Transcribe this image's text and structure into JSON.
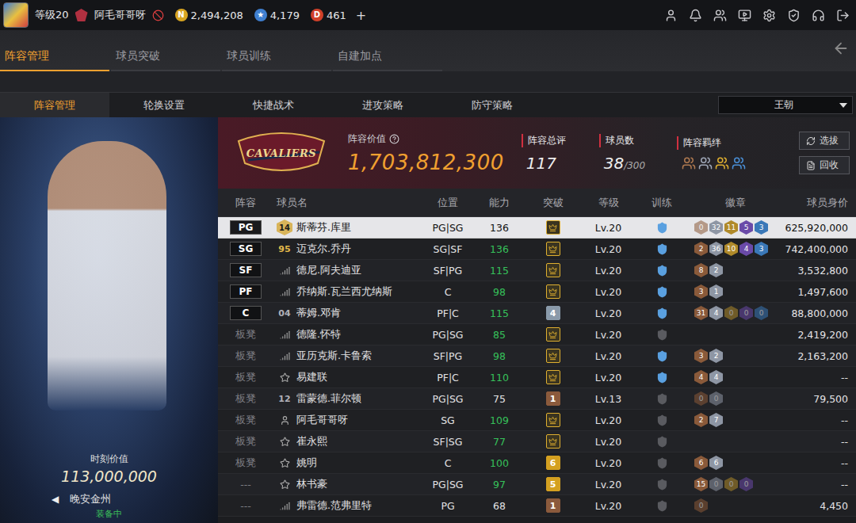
{
  "top_bar": {
    "level": "等级20",
    "player_name": "阿毛哥哥呀",
    "currencies": [
      {
        "icon": "N",
        "value": "2,494,208",
        "color": "#d9a520"
      },
      {
        "icon": "★",
        "value": "4,179",
        "color": "#3f7fd0"
      },
      {
        "icon": "D",
        "value": "461",
        "color": "#d0402a"
      }
    ],
    "add": "+"
  },
  "main_tabs": [
    {
      "label": "阵容管理",
      "selected": true
    },
    {
      "label": "球员突破",
      "selected": false
    },
    {
      "label": "球员训练",
      "selected": false
    },
    {
      "label": "自建加点",
      "selected": false
    }
  ],
  "sub_tabs": [
    {
      "label": "阵容管理",
      "selected": true
    },
    {
      "label": "轮换设置",
      "selected": false
    },
    {
      "label": "快捷战术",
      "selected": false
    },
    {
      "label": "进攻策略",
      "selected": false
    },
    {
      "label": "防守策略",
      "selected": false
    }
  ],
  "dropdown": {
    "value": "王朝"
  },
  "player_card": {
    "value_label": "时刻价值",
    "value": "113,000,000",
    "prev": "◀",
    "name": "晚安金州",
    "status": "装备中"
  },
  "team": {
    "logo_text": "CAVALIERS",
    "value_label": "阵容价值",
    "value": "1,703,812,300",
    "rating_label": "阵容总评",
    "rating": "117",
    "count_label": "球员数",
    "count": "38",
    "count_max": "/300",
    "bonds_label": "阵容羁绊",
    "bonds": [
      {
        "color": "#b07a50"
      },
      {
        "color": "#a0a8b8"
      },
      {
        "color": "#e0b030"
      },
      {
        "color": "#4a90d8"
      }
    ],
    "buttons": [
      "选拔",
      "回收"
    ]
  },
  "table": {
    "columns": [
      "阵容",
      "球员名",
      "位置",
      "能力",
      "突破",
      "等级",
      "训练",
      "徽章",
      "球员身价"
    ],
    "rows": [
      {
        "lineup": "PG",
        "starter": true,
        "marker": {
          "kind": "number",
          "text": "14",
          "color": "#d8b45a"
        },
        "name": "斯蒂芬.库里",
        "position": "PG|SG",
        "ability": "136",
        "boosted": false,
        "breakthrough": {
          "kind": "crown",
          "color": "#e0b030"
        },
        "level": "Lv.20",
        "trained": true,
        "badges": [
          "0",
          "32",
          "11",
          "5",
          "3"
        ],
        "value": "625,920,000",
        "selected": true
      },
      {
        "lineup": "SG",
        "starter": true,
        "marker": {
          "kind": "number",
          "text": "95",
          "color": "#e0b84a"
        },
        "name": "迈克尔.乔丹",
        "position": "SG|SF",
        "ability": "136",
        "boosted": true,
        "breakthrough": {
          "kind": "crown",
          "color": "#e0b030"
        },
        "level": "Lv.20",
        "trained": true,
        "badges": [
          "2",
          "36",
          "10",
          "4",
          "3"
        ],
        "value": "742,400,000",
        "selected": false
      },
      {
        "lineup": "SF",
        "starter": true,
        "marker": {
          "kind": "bars"
        },
        "name": "德尼.阿夫迪亚",
        "position": "SF|PG",
        "ability": "115",
        "boosted": true,
        "breakthrough": {
          "kind": "crown",
          "color": "#e0b030"
        },
        "level": "Lv.20",
        "trained": true,
        "badges": [
          "8",
          "2"
        ],
        "value": "3,532,800",
        "selected": false
      },
      {
        "lineup": "PF",
        "starter": true,
        "marker": {
          "kind": "bars"
        },
        "name": "乔纳斯.瓦兰西尤纳斯",
        "position": "C",
        "ability": "98",
        "boosted": true,
        "breakthrough": {
          "kind": "crown",
          "color": "#e0b030"
        },
        "level": "Lv.20",
        "trained": true,
        "badges": [
          "3",
          "1"
        ],
        "value": "1,497,600",
        "selected": false
      },
      {
        "lineup": "C",
        "starter": true,
        "marker": {
          "kind": "number",
          "text": "04",
          "color": "#b0b0b8"
        },
        "name": "蒂姆.邓肯",
        "position": "PF|C",
        "ability": "115",
        "boosted": true,
        "breakthrough": {
          "kind": "level",
          "text": "4",
          "color": "#8a9aaa"
        },
        "level": "Lv.20",
        "trained": true,
        "badges": [
          "31",
          "4",
          "0",
          "0",
          "0"
        ],
        "value": "88,800,000",
        "selected": false
      },
      {
        "lineup": "板凳",
        "starter": false,
        "marker": {
          "kind": "bars"
        },
        "name": "德隆.怀特",
        "position": "PG|SG",
        "ability": "85",
        "boosted": true,
        "breakthrough": {
          "kind": "crown",
          "color": "#e0b030"
        },
        "level": "Lv.20",
        "trained": false,
        "badges": [],
        "value": "2,419,200",
        "selected": false
      },
      {
        "lineup": "板凳",
        "starter": false,
        "marker": {
          "kind": "bars"
        },
        "name": "亚历克斯.卡鲁索",
        "position": "SF|PG",
        "ability": "98",
        "boosted": true,
        "breakthrough": {
          "kind": "crown",
          "color": "#e0b030"
        },
        "level": "Lv.20",
        "trained": true,
        "badges": [
          "3",
          "2"
        ],
        "value": "2,163,200",
        "selected": false
      },
      {
        "lineup": "板凳",
        "starter": false,
        "marker": {
          "kind": "star"
        },
        "name": "易建联",
        "position": "PF|C",
        "ability": "110",
        "boosted": true,
        "breakthrough": {
          "kind": "crown",
          "color": "#e0b030"
        },
        "level": "Lv.20",
        "trained": true,
        "badges": [
          "4",
          "4"
        ],
        "value": "--",
        "selected": false
      },
      {
        "lineup": "板凳",
        "starter": false,
        "marker": {
          "kind": "number",
          "text": "12",
          "color": "#b0b0b8"
        },
        "name": "雷蒙德.菲尔顿",
        "position": "PG|SG",
        "ability": "75",
        "boosted": false,
        "breakthrough": {
          "kind": "level",
          "text": "1",
          "color": "#8b5a3c"
        },
        "level": "Lv.13",
        "trained": false,
        "badges": [
          "0",
          "0"
        ],
        "value": "79,500",
        "selected": false
      },
      {
        "lineup": "板凳",
        "starter": false,
        "marker": {
          "kind": "person"
        },
        "name": "阿毛哥哥呀",
        "position": "SG",
        "ability": "109",
        "boosted": true,
        "breakthrough": {
          "kind": "crown",
          "color": "#e0b030"
        },
        "level": "Lv.20",
        "trained": false,
        "badges": [
          "2",
          "7"
        ],
        "value": "--",
        "selected": false
      },
      {
        "lineup": "板凳",
        "starter": false,
        "marker": {
          "kind": "star"
        },
        "name": "崔永熙",
        "position": "SF|SG",
        "ability": "77",
        "boosted": true,
        "breakthrough": {
          "kind": "crown",
          "color": "#e0b030"
        },
        "level": "Lv.20",
        "trained": false,
        "badges": [],
        "value": "--",
        "selected": false
      },
      {
        "lineup": "板凳",
        "starter": false,
        "marker": {
          "kind": "star"
        },
        "name": "姚明",
        "position": "C",
        "ability": "100",
        "boosted": true,
        "breakthrough": {
          "kind": "level",
          "text": "6",
          "color": "#d4a020"
        },
        "level": "Lv.20",
        "trained": false,
        "badges": [
          "6",
          "6"
        ],
        "value": "--",
        "selected": false
      },
      {
        "lineup": "---",
        "starter": false,
        "marker": {
          "kind": "star"
        },
        "name": "林书豪",
        "position": "PG|SG",
        "ability": "97",
        "boosted": true,
        "breakthrough": {
          "kind": "level",
          "text": "5",
          "color": "#d4a020"
        },
        "level": "Lv.20",
        "trained": false,
        "badges": [
          "15",
          "0",
          "0",
          "0"
        ],
        "value": "--",
        "selected": false
      },
      {
        "lineup": "---",
        "starter": false,
        "marker": {
          "kind": "bars"
        },
        "name": "弗雷德.范弗里特",
        "position": "PG",
        "ability": "68",
        "boosted": false,
        "breakthrough": {
          "kind": "level",
          "text": "1",
          "color": "#8b5a3c"
        },
        "level": "Lv.20",
        "trained": false,
        "badges": [
          "0"
        ],
        "value": "4,450",
        "selected": false
      }
    ]
  }
}
